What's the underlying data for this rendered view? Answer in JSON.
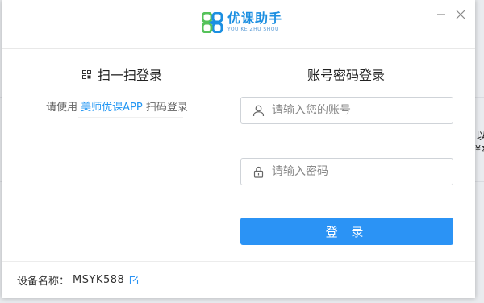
{
  "background": {
    "fragments": [
      "以",
      "¥⊠"
    ]
  },
  "window": {
    "logo_cn": "优课助手",
    "logo_en": "YOU KE ZHU SHOU",
    "minimize_glyph": "—",
    "close_glyph": "✕"
  },
  "qr_login": {
    "title": "扫一扫登录",
    "hint_prefix": "请使用 ",
    "hint_app": "美师优课APP",
    "hint_suffix": " 扫码登录"
  },
  "account_login": {
    "title": "账号密码登录",
    "username_placeholder": "请输入您的账号",
    "password_placeholder": "请输入密码",
    "submit_label": "登 录"
  },
  "footer": {
    "device_label": "设备名称：",
    "device_name": "MSYK588"
  },
  "colors": {
    "accent": "#2b93f5",
    "link": "#2196f3",
    "logo_blue": "#1c8fe1",
    "logo_green": "#55c25a"
  }
}
